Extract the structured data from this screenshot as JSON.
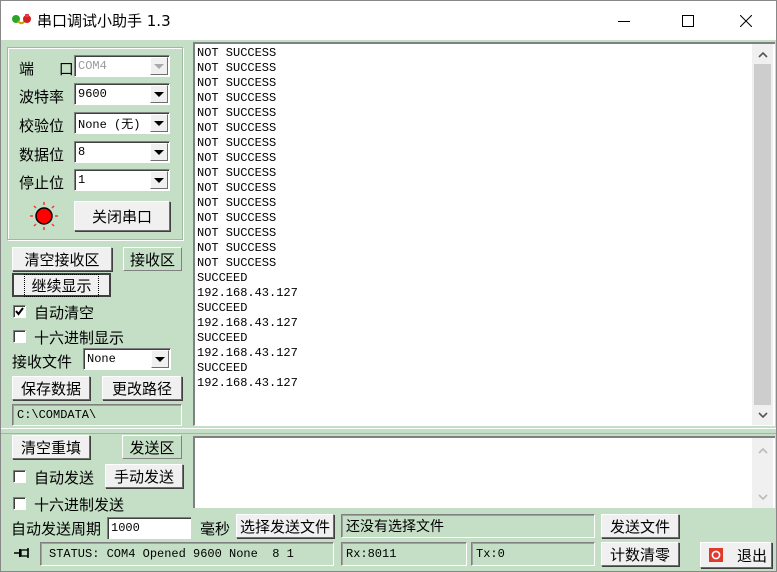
{
  "window": {
    "title": "串口调试小助手 1.3",
    "icon": "serial-port-plug-icon",
    "controls": {
      "minimize": "minimize-icon",
      "maximize": "maximize-icon",
      "close": "close-icon"
    }
  },
  "settings": {
    "port": {
      "label": "端 口",
      "value": "COM4",
      "disabled": true
    },
    "baud": {
      "label": "波特率",
      "value": "9600"
    },
    "parity": {
      "label": "校验位",
      "value": "None (无)"
    },
    "databits": {
      "label": "数据位",
      "value": "8"
    },
    "stopbits": {
      "label": "停止位",
      "value": "1"
    },
    "port_indicator": {
      "icon": "port-status-led-icon",
      "state": "open",
      "color": "#ff0000"
    },
    "toggle_port_button": "关闭串口"
  },
  "receive": {
    "clear_button": "清空接收区",
    "area_label": "接收区",
    "pause_button": "继续显示",
    "auto_clear": {
      "label": "自动清空",
      "checked": true
    },
    "hex_display": {
      "label": "十六进制显示",
      "checked": false
    },
    "file_label": "接收文件",
    "file_value": "None",
    "save_button": "保存数据",
    "change_path_button": "更改路径",
    "path": "C:\\COMDATA\\",
    "lines": [
      "NOT SUCCESS",
      "NOT SUCCESS",
      "NOT SUCCESS",
      "NOT SUCCESS",
      "NOT SUCCESS",
      "NOT SUCCESS",
      "NOT SUCCESS",
      "NOT SUCCESS",
      "NOT SUCCESS",
      "NOT SUCCESS",
      "NOT SUCCESS",
      "NOT SUCCESS",
      "NOT SUCCESS",
      "NOT SUCCESS",
      "NOT SUCCESS",
      "SUCCEED",
      "192.168.43.127",
      "SUCCEED",
      "192.168.43.127",
      "SUCCEED",
      "192.168.43.127",
      "SUCCEED",
      "192.168.43.127"
    ]
  },
  "send": {
    "clear_button": "清空重填",
    "area_label": "发送区",
    "auto_send": {
      "label": "自动发送",
      "checked": false
    },
    "manual_send_button": "手动发送",
    "hex_send": {
      "label": "十六进制发送",
      "checked": false
    },
    "period_label": "自动发送周期",
    "period_value": "1000",
    "period_unit": "毫秒",
    "choose_file_button": "选择发送文件",
    "file_status": "还没有选择文件",
    "send_file_button": "发送文件",
    "text": ""
  },
  "statusbar": {
    "pin_icon": "pin-icon",
    "status": "STATUS: COM4 Opened 9600 None  8 1",
    "rx": "Rx:8011",
    "tx": "Tx:0",
    "reset_counter_button": "计数清零",
    "exit_button": "退出",
    "exit_icon": "power-icon"
  }
}
